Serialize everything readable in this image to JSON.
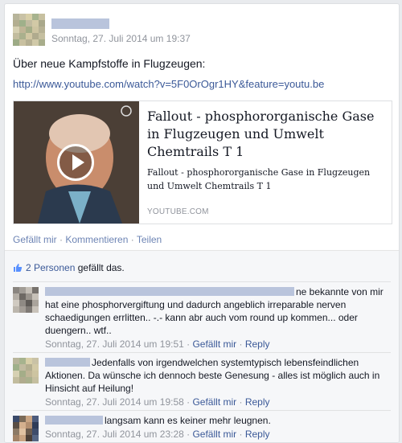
{
  "post": {
    "timestamp": "Sonntag, 27. Juli 2014 um 19:37",
    "text": "Über neue Kampfstoffe in Flugzeugen:",
    "link": "http://www.youtube.com/watch?v=5F0OrOgr1HY&feature=youtu.be"
  },
  "attachment": {
    "title": "Fallout - phosphororganische Gase in Flugzeugen und Umwelt Chemtrails T 1",
    "description": "Fallout - phosphororganische Gase in Flugzeugen und Umwelt Chemtrails T 1",
    "domain": "YOUTUBE.COM"
  },
  "actions": {
    "like": "Gefällt mir",
    "sep1": " · ",
    "comment": "Kommentieren",
    "sep2": " · ",
    "share": "Teilen"
  },
  "likes": {
    "count_link": "2 Personen",
    "suffix": " gefällt das."
  },
  "comments": [
    {
      "text": "ne bekannte von mir hat eine phosphorvergiftung und dadurch angeblich irreparable nerven schaedigungen errlitten.. -.- kann abr auch vom round up kommen... oder duengern.. wtf..",
      "time": "Sonntag, 27. Juli 2014 um 19:51",
      "sep": " · ",
      "like": "Gefällt mir",
      "sep2": " · ",
      "reply": "Reply"
    },
    {
      "text": "Jedenfalls von irgendwelchen systemtypisch lebensfeindlichen Aktionen. Da wünsche ich dennoch beste Genesung - alles ist möglich auch in Hinsicht auf Heilung!",
      "time": "Sonntag, 27. Juli 2014 um 19:58",
      "sep": " · ",
      "like": "Gefällt mir",
      "sep2": " · ",
      "reply": "Reply"
    },
    {
      "text": "langsam kann es keiner mehr leugnen.",
      "time": "Sonntag, 27. Juli 2014 um 23:28",
      "sep": " · ",
      "like": "Gefällt mir",
      "sep2": " · ",
      "reply": "Reply"
    }
  ],
  "colors": {
    "link": "#3b5998",
    "meta": "#90949c",
    "background": "#e9ebee"
  },
  "icons": {
    "like": "thumbs-up-icon",
    "play": "play-icon"
  }
}
